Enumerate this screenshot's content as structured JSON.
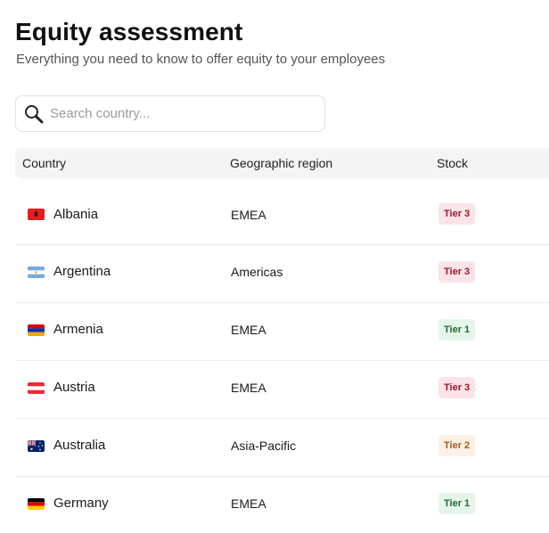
{
  "page": {
    "title": "Equity assessment",
    "subtitle": "Everything you need to know to offer equity to your employees"
  },
  "search": {
    "placeholder": "Search country...",
    "icon": "search-icon"
  },
  "table": {
    "columns": [
      "Country",
      "Geographic region",
      "Stock"
    ],
    "rows": [
      {
        "country": "Albania",
        "flag": "flag-albania",
        "region": "EMEA",
        "stock": "Tier 3"
      },
      {
        "country": "Argentina",
        "flag": "flag-argentina",
        "region": "Americas",
        "stock": "Tier 3"
      },
      {
        "country": "Armenia",
        "flag": "flag-armenia",
        "region": "EMEA",
        "stock": "Tier 1"
      },
      {
        "country": "Austria",
        "flag": "flag-austria",
        "region": "EMEA",
        "stock": "Tier 3"
      },
      {
        "country": "Australia",
        "flag": "flag-australia",
        "region": "Asia-Pacific",
        "stock": "Tier 2"
      },
      {
        "country": "Germany",
        "flag": "flag-germany",
        "region": "EMEA",
        "stock": "Tier 1"
      }
    ]
  },
  "colors": {
    "tier_1_bg": "#e6f5e9",
    "tier_1_text": "#1d6b2e",
    "tier_2_bg": "#fdf1e6",
    "tier_2_text": "#a05b1a",
    "tier_3_bg": "#fbe4e8",
    "tier_3_text": "#a3132b",
    "header_bg": "#f4f4f4"
  }
}
